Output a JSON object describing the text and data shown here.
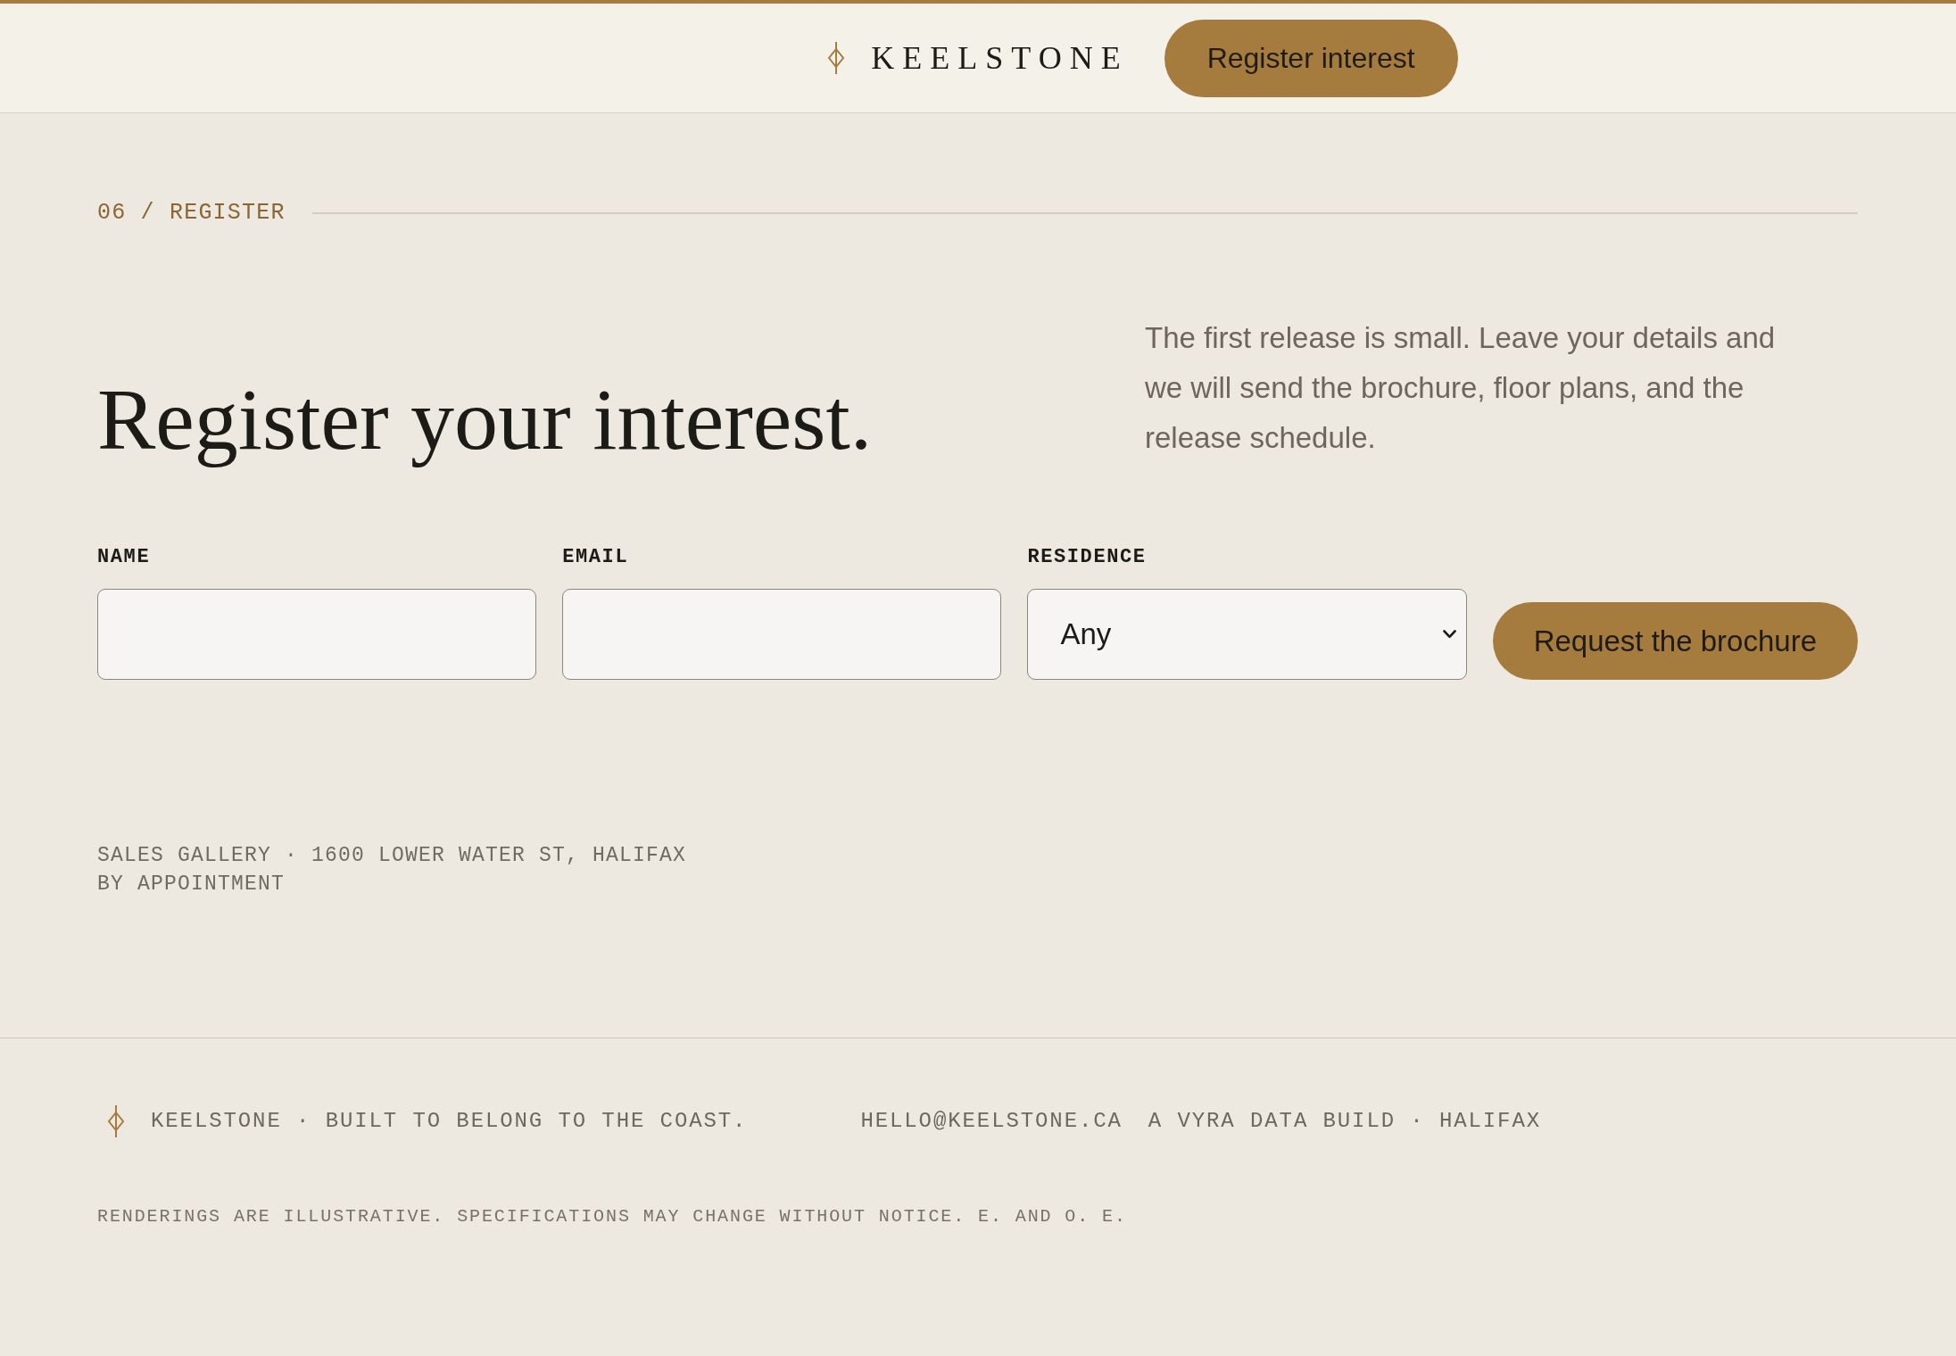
{
  "header": {
    "brand": "KEELSTONE",
    "cta": "Register interest"
  },
  "section": {
    "label": "06 / REGISTER",
    "heading": "Register your interest.",
    "intro": "The first release is small. Leave your details and we will send the brochure, floor plans, and the release schedule."
  },
  "form": {
    "fields": [
      {
        "kind": "text",
        "label": "NAME"
      },
      {
        "kind": "email",
        "label": "EMAIL"
      },
      {
        "kind": "select",
        "label": "RESIDENCE",
        "value": "Any"
      }
    ],
    "submit": "Request the brochure"
  },
  "address": {
    "lines": [
      "SALES GALLERY · 1600 LOWER WATER ST, HALIFAX",
      "BY APPOINTMENT"
    ]
  },
  "footer": {
    "tagline": "KEELSTONE · BUILT TO BELONG TO THE COAST.",
    "email": "HELLO@KEELSTONE.CA",
    "credit": "A VYRA DATA BUILD · HALIFAX",
    "disclaimer": "RENDERINGS ARE ILLUSTRATIVE. SPECIFICATIONS MAY CHANGE WITHOUT NOTICE. E. AND O. E."
  }
}
